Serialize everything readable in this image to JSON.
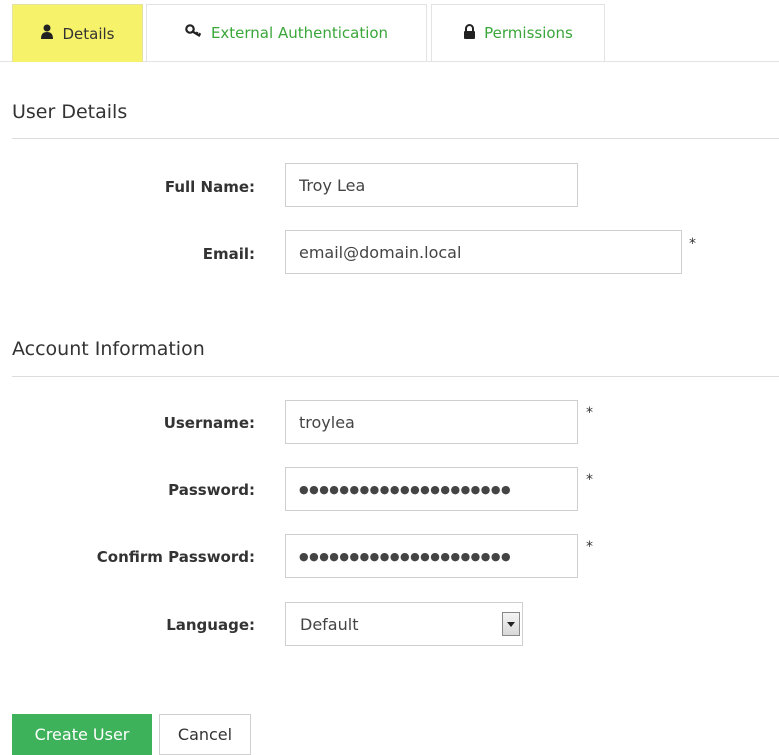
{
  "tabs": [
    {
      "label": "Details",
      "icon": "user-icon",
      "active": true
    },
    {
      "label": "External Authentication",
      "icon": "key-icon",
      "active": false
    },
    {
      "label": "Permissions",
      "icon": "lock-icon",
      "active": false
    }
  ],
  "user_details": {
    "title": "User Details",
    "full_name_label": "Full Name:",
    "full_name_value": "Troy Lea",
    "email_label": "Email:",
    "email_value": "email@domain.local",
    "email_required": "*"
  },
  "account_info": {
    "title": "Account Information",
    "username_label": "Username:",
    "username_value": "troylea",
    "username_required": "*",
    "password_label": "Password:",
    "password_value": "●●●●●●●●●●●●●●●●●●●●●",
    "password_required": "*",
    "confirm_label": "Confirm Password:",
    "confirm_value": "●●●●●●●●●●●●●●●●●●●●●",
    "confirm_required": "*",
    "language_label": "Language:",
    "language_value": "Default"
  },
  "actions": {
    "create_label": "Create User",
    "cancel_label": "Cancel"
  },
  "colors": {
    "active_tab": "#f6f26a",
    "tab_link": "#3aa63a",
    "primary_button": "#3db25a"
  }
}
